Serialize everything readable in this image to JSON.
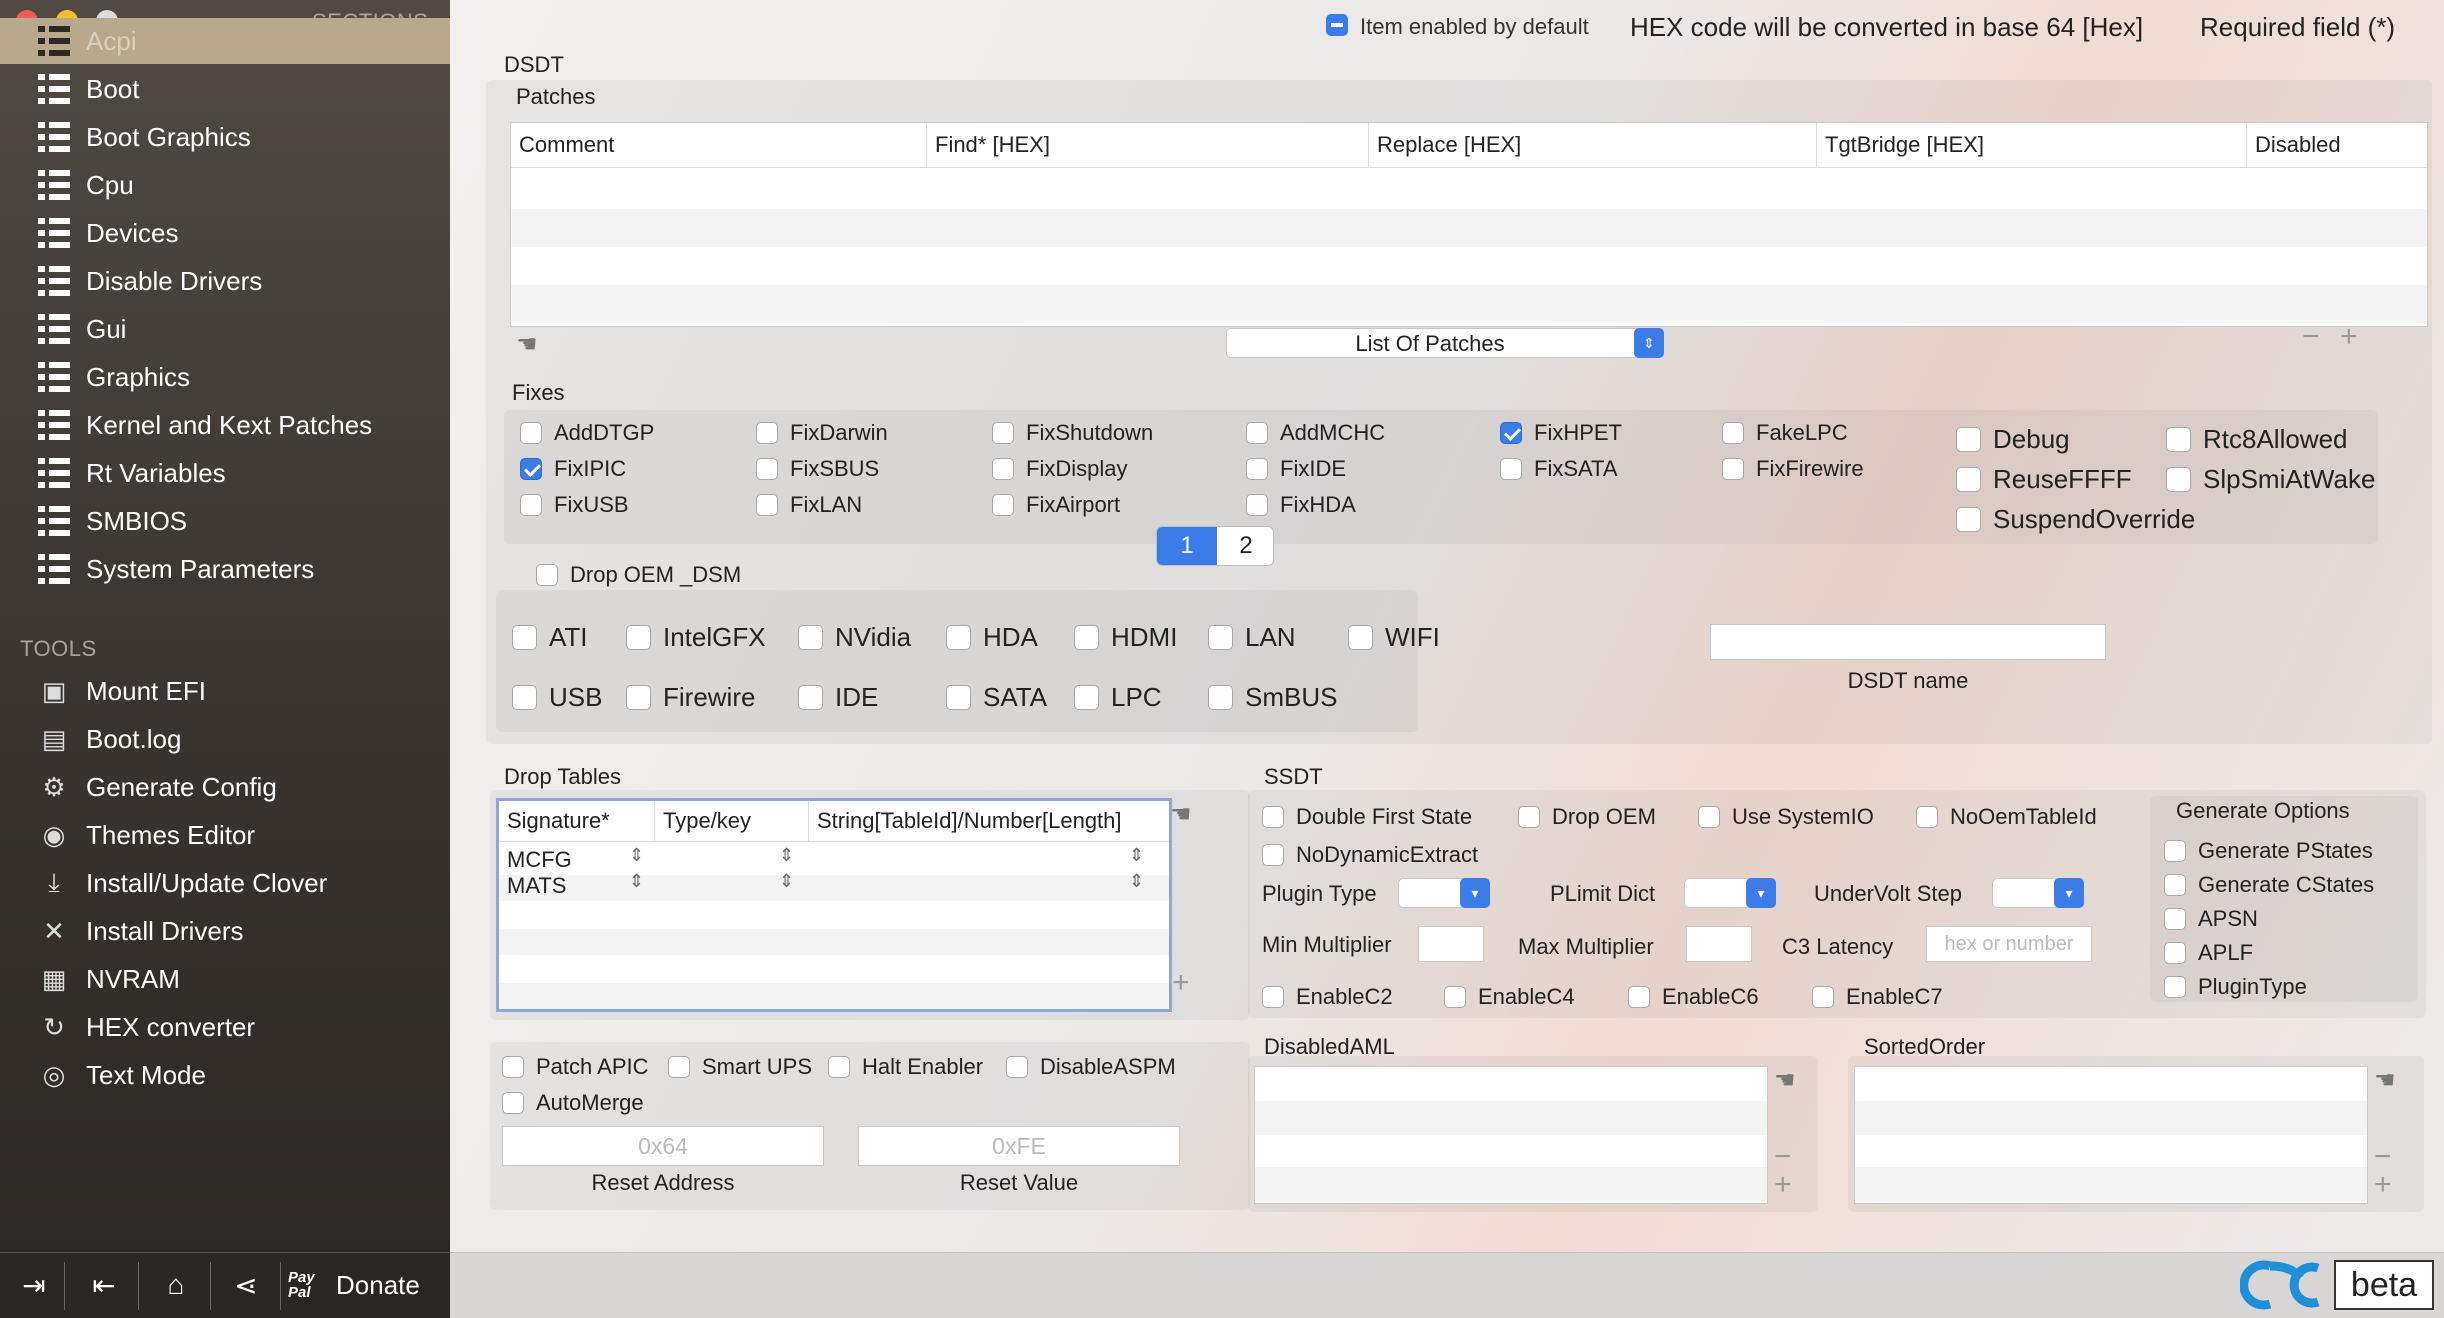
{
  "window": {
    "traffic_lights": {
      "close": "#f25c54",
      "minimize": "#f5bf2c",
      "zoom": "#dcdcdc"
    }
  },
  "sidebar": {
    "sections_heading": "SECTIONS",
    "sections": [
      "Acpi",
      "Boot",
      "Boot Graphics",
      "Cpu",
      "Devices",
      "Disable Drivers",
      "Gui",
      "Graphics",
      "Kernel and Kext Patches",
      "Rt Variables",
      "SMBIOS",
      "System Parameters"
    ],
    "selected": "Acpi",
    "tools_heading": "TOOLS",
    "tools": [
      {
        "label": "Mount EFI",
        "icon": "disk-icon"
      },
      {
        "label": "Boot.log",
        "icon": "log-icon"
      },
      {
        "label": "Generate Config",
        "icon": "gears-icon"
      },
      {
        "label": "Themes Editor",
        "icon": "palette-icon"
      },
      {
        "label": "Install/Update Clover",
        "icon": "download-icon"
      },
      {
        "label": "Install Drivers",
        "icon": "tools-icon"
      },
      {
        "label": "NVRAM",
        "icon": "chip-icon"
      },
      {
        "label": "HEX converter",
        "icon": "refresh-icon"
      },
      {
        "label": "Text Mode",
        "icon": "eye-icon"
      }
    ],
    "bottom": {
      "paypal_text": "Pay\nPal",
      "donate": "Donate"
    }
  },
  "legend": {
    "enabled_label": "Item enabled by default",
    "hex_note": "HEX code will be converted in base 64 [Hex]",
    "required_note": "Required field (*)"
  },
  "dsdt": {
    "title": "DSDT",
    "patches_title": "Patches",
    "patches_columns": [
      "Comment",
      "Find* [HEX]",
      "Replace [HEX]",
      "TgtBridge [HEX]",
      "Disabled"
    ],
    "list_popup": "List Of Patches",
    "fixes_title": "Fixes",
    "fixes": [
      {
        "label": "AddDTGP",
        "checked": false
      },
      {
        "label": "FixDarwin",
        "checked": false
      },
      {
        "label": "FixShutdown",
        "checked": false
      },
      {
        "label": "AddMCHC",
        "checked": false
      },
      {
        "label": "FixHPET",
        "checked": true
      },
      {
        "label": "FakeLPC",
        "checked": false
      },
      {
        "label": "FixIPIC",
        "checked": true
      },
      {
        "label": "FixSBUS",
        "checked": false
      },
      {
        "label": "FixDisplay",
        "checked": false
      },
      {
        "label": "FixIDE",
        "checked": false
      },
      {
        "label": "FixSATA",
        "checked": false
      },
      {
        "label": "FixFirewire",
        "checked": false
      },
      {
        "label": "FixUSB",
        "checked": false
      },
      {
        "label": "FixLAN",
        "checked": false
      },
      {
        "label": "FixAirport",
        "checked": false
      },
      {
        "label": "FixHDA",
        "checked": false
      }
    ],
    "pages": [
      "1",
      "2"
    ],
    "active_page": "1",
    "right_options": [
      {
        "label": "Debug",
        "checked": false
      },
      {
        "label": "Rtc8Allowed",
        "checked": false
      },
      {
        "label": "ReuseFFFF",
        "checked": false
      },
      {
        "label": "SlpSmiAtWake",
        "checked": false
      },
      {
        "label": "SuspendOverride",
        "checked": false
      }
    ],
    "drop_oem_dsm": "Drop OEM _DSM",
    "devices": [
      {
        "label": "ATI"
      },
      {
        "label": "IntelGFX"
      },
      {
        "label": "NVidia"
      },
      {
        "label": "HDA"
      },
      {
        "label": "HDMI"
      },
      {
        "label": "LAN"
      },
      {
        "label": "WIFI"
      },
      {
        "label": "USB"
      },
      {
        "label": "Firewire"
      },
      {
        "label": "IDE"
      },
      {
        "label": "SATA"
      },
      {
        "label": "LPC"
      },
      {
        "label": "SmBUS"
      }
    ],
    "dsdt_name_label": "DSDT name",
    "dsdt_name_value": ""
  },
  "drop_tables": {
    "title": "Drop Tables",
    "columns": [
      "Signature*",
      "Type/key",
      "String[TableId]/Number[Length]"
    ],
    "rows": [
      {
        "signature": "MCFG"
      },
      {
        "signature": "MATS"
      }
    ]
  },
  "misc": {
    "options": [
      {
        "label": "Patch APIC"
      },
      {
        "label": "Smart UPS"
      },
      {
        "label": "Halt Enabler"
      },
      {
        "label": "DisableASPM"
      },
      {
        "label": "AutoMerge"
      }
    ],
    "reset_address_label": "Reset Address",
    "reset_address_placeholder": "0x64",
    "reset_value_label": "Reset Value",
    "reset_value_placeholder": "0xFE"
  },
  "ssdt": {
    "title": "SSDT",
    "options": [
      {
        "label": "Double First State"
      },
      {
        "label": "Drop OEM"
      },
      {
        "label": "Use SystemIO"
      },
      {
        "label": "NoOemTableId"
      },
      {
        "label": "NoDynamicExtract"
      }
    ],
    "plugin_type": "Plugin Type",
    "plimit_dict": "PLimit Dict",
    "undervolt_step": "UnderVolt Step",
    "min_multiplier": "Min Multiplier",
    "max_multiplier": "Max Multiplier",
    "c3_latency": "C3 Latency",
    "c3_placeholder": "hex or number",
    "enable_c": [
      {
        "label": "EnableC2"
      },
      {
        "label": "EnableC4"
      },
      {
        "label": "EnableC6"
      },
      {
        "label": "EnableC7"
      }
    ],
    "generate_options_title": "Generate Options",
    "generate_options": [
      {
        "label": "Generate PStates"
      },
      {
        "label": "Generate CStates"
      },
      {
        "label": "APSN"
      },
      {
        "label": "APLF"
      },
      {
        "label": "PluginType"
      }
    ]
  },
  "disabled_aml": {
    "title": "DisabledAML"
  },
  "sorted_order": {
    "title": "SortedOrder"
  },
  "brand": {
    "logo_text": "OC",
    "beta": "beta",
    "color": "#1f8fd8"
  }
}
